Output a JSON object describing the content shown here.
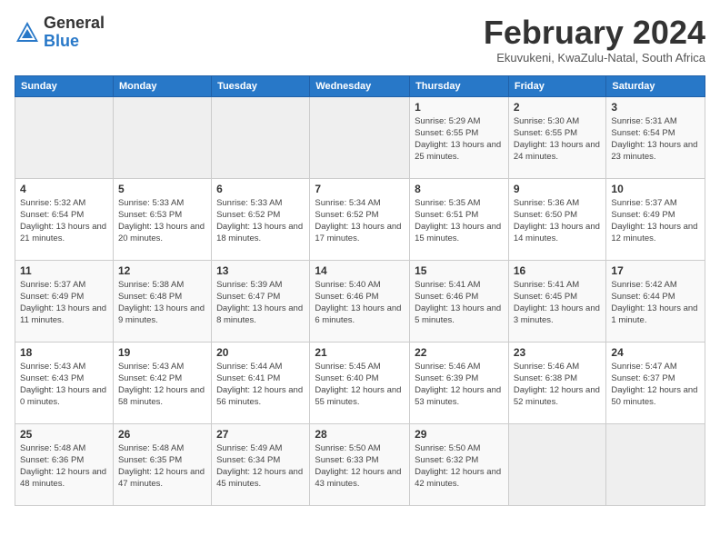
{
  "header": {
    "logo_general": "General",
    "logo_blue": "Blue",
    "month_title": "February 2024",
    "location": "Ekuvukeni, KwaZulu-Natal, South Africa"
  },
  "days_of_week": [
    "Sunday",
    "Monday",
    "Tuesday",
    "Wednesday",
    "Thursday",
    "Friday",
    "Saturday"
  ],
  "weeks": [
    [
      {
        "day": "",
        "info": ""
      },
      {
        "day": "",
        "info": ""
      },
      {
        "day": "",
        "info": ""
      },
      {
        "day": "",
        "info": ""
      },
      {
        "day": "1",
        "info": "Sunrise: 5:29 AM\nSunset: 6:55 PM\nDaylight: 13 hours and 25 minutes."
      },
      {
        "day": "2",
        "info": "Sunrise: 5:30 AM\nSunset: 6:55 PM\nDaylight: 13 hours and 24 minutes."
      },
      {
        "day": "3",
        "info": "Sunrise: 5:31 AM\nSunset: 6:54 PM\nDaylight: 13 hours and 23 minutes."
      }
    ],
    [
      {
        "day": "4",
        "info": "Sunrise: 5:32 AM\nSunset: 6:54 PM\nDaylight: 13 hours and 21 minutes."
      },
      {
        "day": "5",
        "info": "Sunrise: 5:33 AM\nSunset: 6:53 PM\nDaylight: 13 hours and 20 minutes."
      },
      {
        "day": "6",
        "info": "Sunrise: 5:33 AM\nSunset: 6:52 PM\nDaylight: 13 hours and 18 minutes."
      },
      {
        "day": "7",
        "info": "Sunrise: 5:34 AM\nSunset: 6:52 PM\nDaylight: 13 hours and 17 minutes."
      },
      {
        "day": "8",
        "info": "Sunrise: 5:35 AM\nSunset: 6:51 PM\nDaylight: 13 hours and 15 minutes."
      },
      {
        "day": "9",
        "info": "Sunrise: 5:36 AM\nSunset: 6:50 PM\nDaylight: 13 hours and 14 minutes."
      },
      {
        "day": "10",
        "info": "Sunrise: 5:37 AM\nSunset: 6:49 PM\nDaylight: 13 hours and 12 minutes."
      }
    ],
    [
      {
        "day": "11",
        "info": "Sunrise: 5:37 AM\nSunset: 6:49 PM\nDaylight: 13 hours and 11 minutes."
      },
      {
        "day": "12",
        "info": "Sunrise: 5:38 AM\nSunset: 6:48 PM\nDaylight: 13 hours and 9 minutes."
      },
      {
        "day": "13",
        "info": "Sunrise: 5:39 AM\nSunset: 6:47 PM\nDaylight: 13 hours and 8 minutes."
      },
      {
        "day": "14",
        "info": "Sunrise: 5:40 AM\nSunset: 6:46 PM\nDaylight: 13 hours and 6 minutes."
      },
      {
        "day": "15",
        "info": "Sunrise: 5:41 AM\nSunset: 6:46 PM\nDaylight: 13 hours and 5 minutes."
      },
      {
        "day": "16",
        "info": "Sunrise: 5:41 AM\nSunset: 6:45 PM\nDaylight: 13 hours and 3 minutes."
      },
      {
        "day": "17",
        "info": "Sunrise: 5:42 AM\nSunset: 6:44 PM\nDaylight: 13 hours and 1 minute."
      }
    ],
    [
      {
        "day": "18",
        "info": "Sunrise: 5:43 AM\nSunset: 6:43 PM\nDaylight: 13 hours and 0 minutes."
      },
      {
        "day": "19",
        "info": "Sunrise: 5:43 AM\nSunset: 6:42 PM\nDaylight: 12 hours and 58 minutes."
      },
      {
        "day": "20",
        "info": "Sunrise: 5:44 AM\nSunset: 6:41 PM\nDaylight: 12 hours and 56 minutes."
      },
      {
        "day": "21",
        "info": "Sunrise: 5:45 AM\nSunset: 6:40 PM\nDaylight: 12 hours and 55 minutes."
      },
      {
        "day": "22",
        "info": "Sunrise: 5:46 AM\nSunset: 6:39 PM\nDaylight: 12 hours and 53 minutes."
      },
      {
        "day": "23",
        "info": "Sunrise: 5:46 AM\nSunset: 6:38 PM\nDaylight: 12 hours and 52 minutes."
      },
      {
        "day": "24",
        "info": "Sunrise: 5:47 AM\nSunset: 6:37 PM\nDaylight: 12 hours and 50 minutes."
      }
    ],
    [
      {
        "day": "25",
        "info": "Sunrise: 5:48 AM\nSunset: 6:36 PM\nDaylight: 12 hours and 48 minutes."
      },
      {
        "day": "26",
        "info": "Sunrise: 5:48 AM\nSunset: 6:35 PM\nDaylight: 12 hours and 47 minutes."
      },
      {
        "day": "27",
        "info": "Sunrise: 5:49 AM\nSunset: 6:34 PM\nDaylight: 12 hours and 45 minutes."
      },
      {
        "day": "28",
        "info": "Sunrise: 5:50 AM\nSunset: 6:33 PM\nDaylight: 12 hours and 43 minutes."
      },
      {
        "day": "29",
        "info": "Sunrise: 5:50 AM\nSunset: 6:32 PM\nDaylight: 12 hours and 42 minutes."
      },
      {
        "day": "",
        "info": ""
      },
      {
        "day": "",
        "info": ""
      }
    ]
  ]
}
